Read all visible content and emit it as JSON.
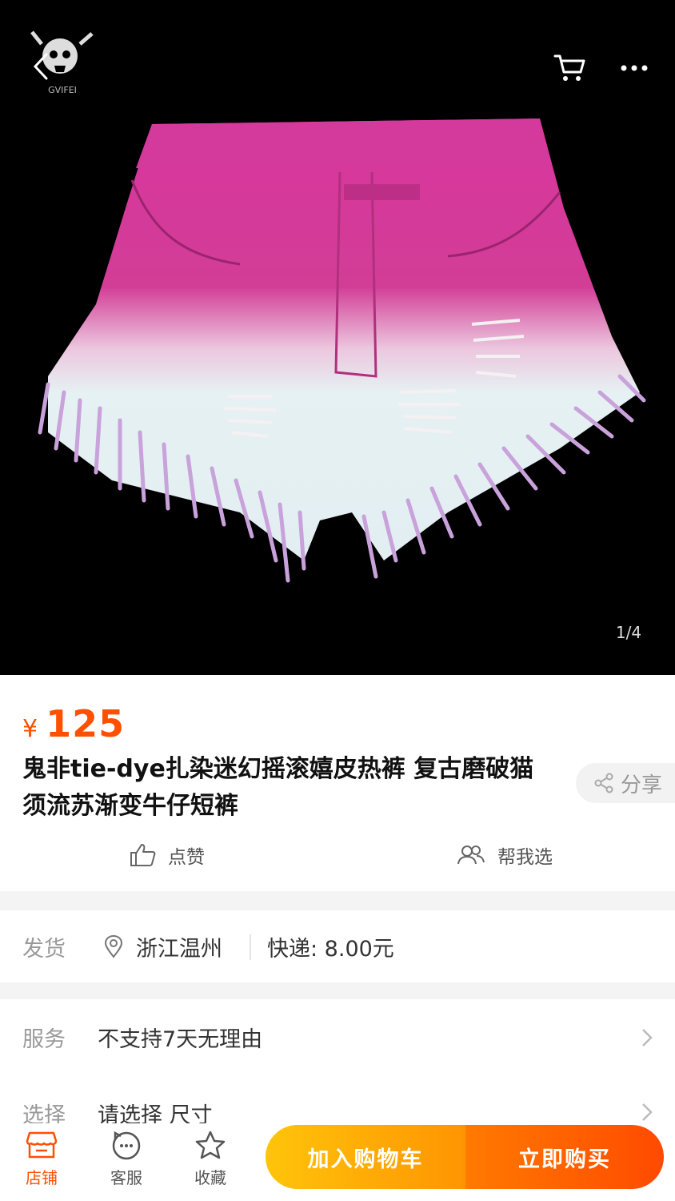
{
  "gallery": {
    "brand": "GVIFEI",
    "page_indicator": "1/4"
  },
  "product": {
    "price_symbol": "¥",
    "price": "125",
    "title": "鬼非tie-dye扎染迷幻摇滚嬉皮热裤 复古磨破猫须流苏渐变牛仔短裤",
    "share_label": "分享",
    "like_label": "点赞",
    "help_label": "帮我选"
  },
  "shipping": {
    "label": "发货",
    "location": "浙江温州",
    "express": "快递: 8.00元"
  },
  "service": {
    "label": "服务",
    "text": "不支持7天无理由"
  },
  "select": {
    "label": "选择",
    "text": "请选择 尺寸"
  },
  "bottom_bar": {
    "store_label": "店铺",
    "service_label": "客服",
    "favorite_label": "收藏",
    "add_cart_label": "加入购物车",
    "buy_now_label": "立即购买"
  },
  "colors": {
    "accent": "#ff5000",
    "cart_button": "#ffa200",
    "buy_button": "#ff5a00",
    "shorts_top": "#d8349c",
    "shorts_bottom": "#e3f0f2",
    "fringe": "#c9a2dc"
  },
  "icons": [
    "back-icon",
    "cart-icon",
    "more-icon",
    "share-icon",
    "thumbs-up-icon",
    "people-icon",
    "location-icon",
    "chevron-right-icon",
    "store-icon",
    "chat-face-icon",
    "star-icon"
  ]
}
